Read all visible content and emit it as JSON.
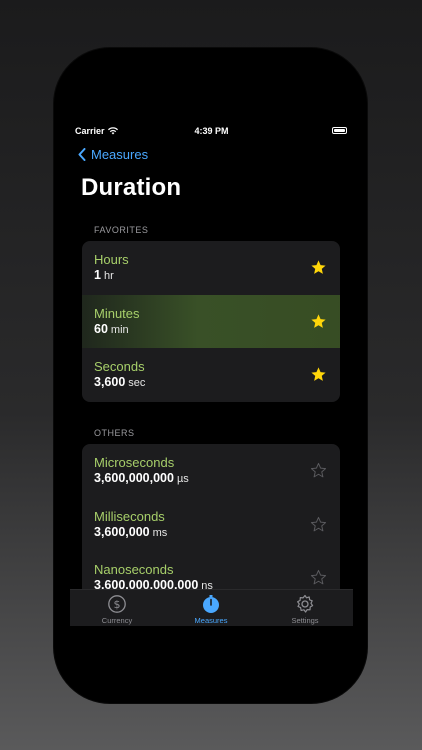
{
  "status_bar": {
    "carrier": "Carrier",
    "time": "4:39 PM"
  },
  "nav": {
    "back_label": "Measures",
    "title": "Duration"
  },
  "favorites": {
    "header": "FAVORITES",
    "items": [
      {
        "name": "Hours",
        "value": "1",
        "unit": "hr",
        "starred": true
      },
      {
        "name": "Minutes",
        "value": "60",
        "unit": "min",
        "starred": true
      },
      {
        "name": "Seconds",
        "value": "3,600",
        "unit": "sec",
        "starred": true
      }
    ]
  },
  "others": {
    "header": "OTHERS",
    "items": [
      {
        "name": "Microseconds",
        "value": "3,600,000,000",
        "unit": "µs",
        "starred": false
      },
      {
        "name": "Milliseconds",
        "value": "3,600,000",
        "unit": "ms",
        "starred": false
      },
      {
        "name": "Nanoseconds",
        "value": "3,600,000,000,000",
        "unit": "ns",
        "starred": false
      }
    ]
  },
  "tabs": [
    {
      "label": "Currency",
      "icon": "dollar-circle-icon",
      "active": false
    },
    {
      "label": "Measures",
      "icon": "stopwatch-icon",
      "active": true
    },
    {
      "label": "Settings",
      "icon": "gear-icon",
      "active": false
    }
  ],
  "colors": {
    "accent": "#4aa8ff",
    "unit_name": "#a7cf6a",
    "star_filled": "#ffd60a"
  }
}
